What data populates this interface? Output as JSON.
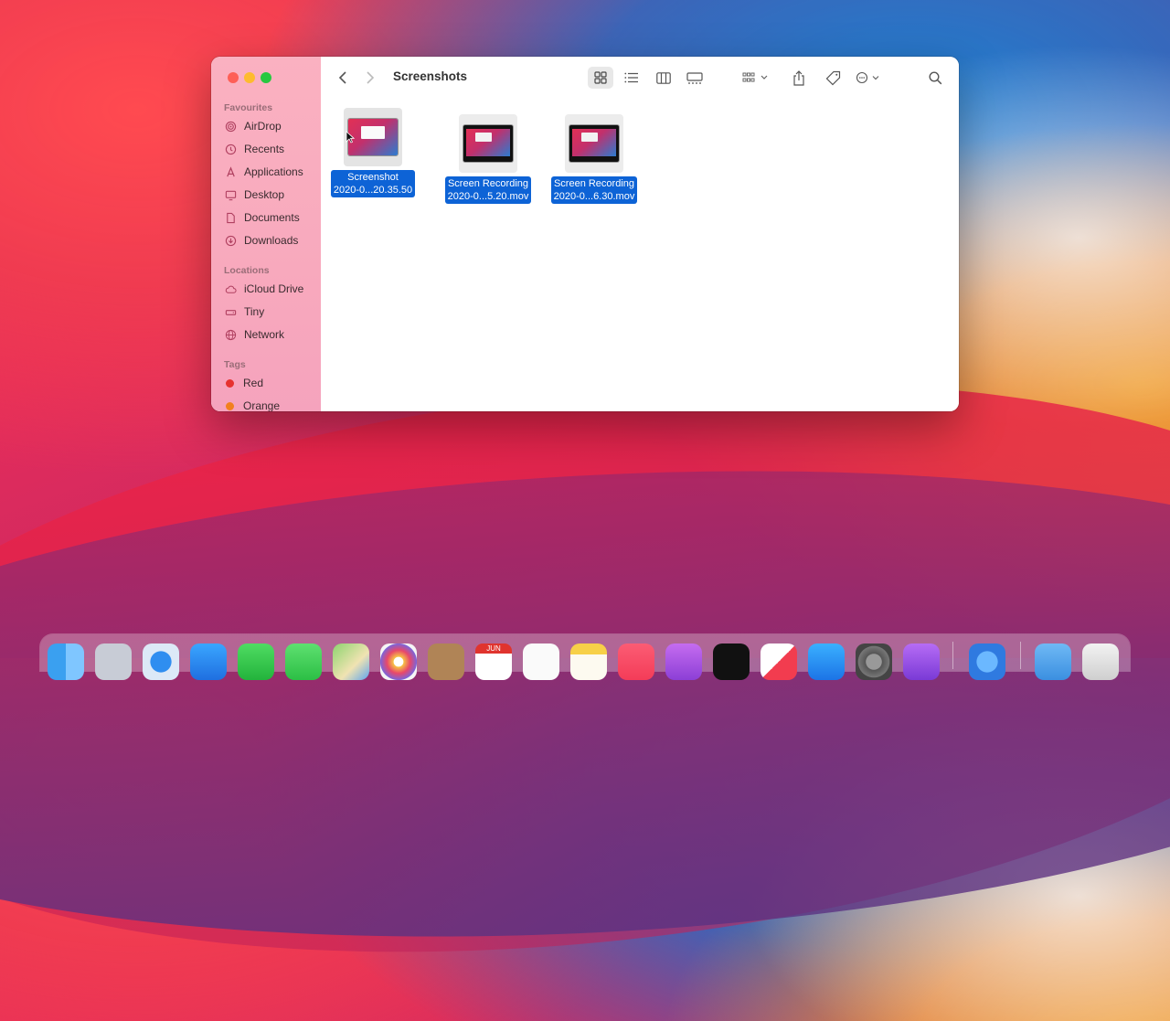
{
  "window": {
    "title": "Screenshots",
    "sidebar": {
      "favourites_title": "Favourites",
      "favourites": [
        {
          "label": "AirDrop",
          "icon": "airdrop-icon"
        },
        {
          "label": "Recents",
          "icon": "clock-icon"
        },
        {
          "label": "Applications",
          "icon": "applications-icon"
        },
        {
          "label": "Desktop",
          "icon": "desktop-icon"
        },
        {
          "label": "Documents",
          "icon": "document-icon"
        },
        {
          "label": "Downloads",
          "icon": "download-icon"
        }
      ],
      "locations_title": "Locations",
      "locations": [
        {
          "label": "iCloud Drive",
          "icon": "cloud-icon"
        },
        {
          "label": "Tiny",
          "icon": "disk-icon"
        },
        {
          "label": "Network",
          "icon": "globe-icon"
        }
      ],
      "tags_title": "Tags",
      "tags": [
        {
          "label": "Red",
          "color": "#e6322f"
        },
        {
          "label": "Orange",
          "color": "#f2801e"
        }
      ]
    },
    "toolbar": {
      "icons": [
        "back-icon",
        "forward-icon",
        "icon-view-icon",
        "list-view-icon",
        "column-view-icon",
        "gallery-view-icon",
        "group-icon",
        "share-icon",
        "tag-icon",
        "more-icon",
        "search-icon"
      ]
    },
    "files": [
      {
        "line1": "Screenshot",
        "line2": "2020-0...20.35.50",
        "kind": "screenshot"
      },
      {
        "line1": "Screen Recording",
        "line2": "2020-0...5.20.mov",
        "kind": "recording"
      },
      {
        "line1": "Screen Recording",
        "line2": "2020-0...6.30.mov",
        "kind": "recording"
      }
    ]
  },
  "dock": {
    "calendar_month": "JUN",
    "apps": [
      "finder-icon",
      "launchpad-icon",
      "safari-icon",
      "mail-icon",
      "facetime-icon",
      "messages-icon",
      "maps-icon",
      "photos-icon",
      "contacts-icon",
      "calendar-icon",
      "reminders-icon",
      "notes-icon",
      "music-icon",
      "podcasts-icon",
      "tv-icon",
      "news-icon",
      "app-store-icon",
      "system-preferences-icon",
      "feedback-icon",
      "screen-time-icon",
      "downloads-folder-icon",
      "trash-icon"
    ]
  },
  "colors": {
    "selection": "#0d63d6",
    "sidebar": "#f8a9bd"
  }
}
